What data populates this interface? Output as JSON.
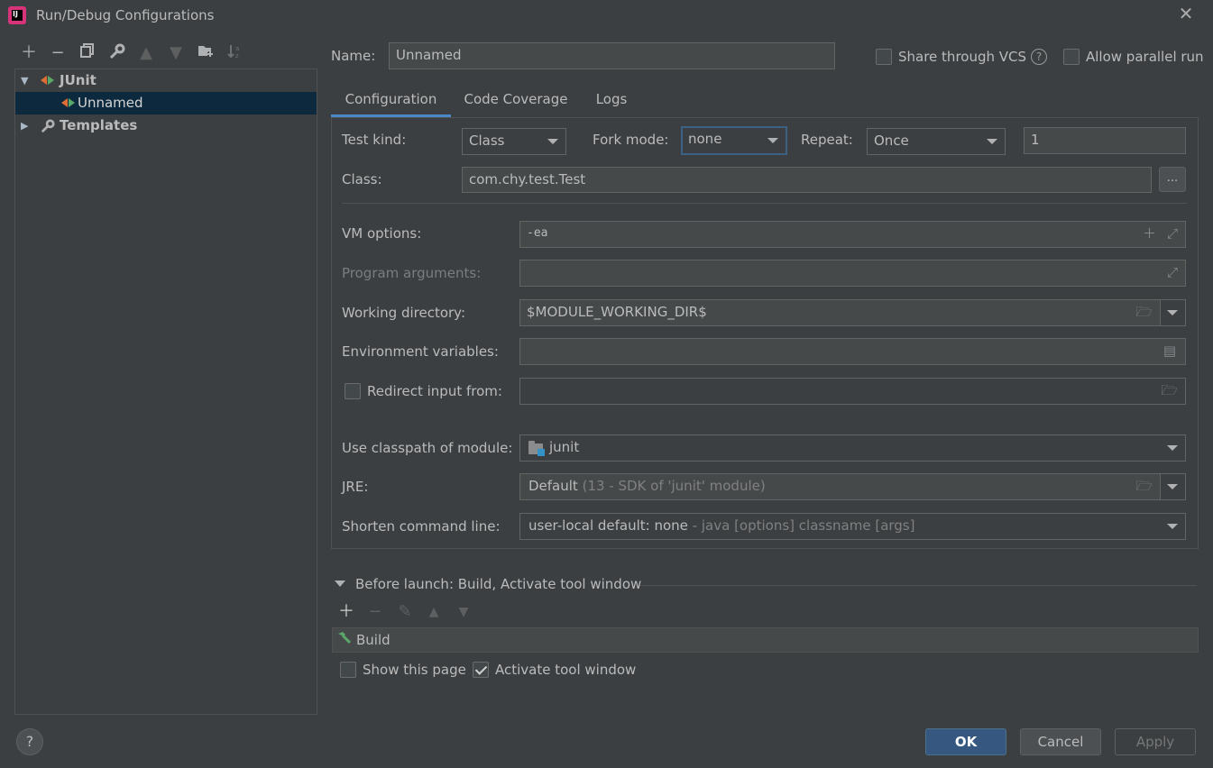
{
  "window": {
    "title": "Run/Debug Configurations",
    "logo_text": "IJ"
  },
  "toolbar": {
    "icons": [
      "add-icon",
      "remove-icon",
      "copy-icon",
      "wrench-icon",
      "move-up-icon",
      "move-down-icon",
      "new-folder-icon",
      "sort-icon"
    ]
  },
  "tree": {
    "group_label": "JUnit",
    "config_label": "Unnamed",
    "templates_label": "Templates"
  },
  "header": {
    "name_label": "Name:",
    "name_value": "Unnamed",
    "share_label": "Share through VCS",
    "help_glyph": "?",
    "parallel_label": "Allow parallel run"
  },
  "tabs": [
    {
      "label": "Configuration"
    },
    {
      "label": "Code Coverage"
    },
    {
      "label": "Logs"
    }
  ],
  "config": {
    "test_kind_label": "Test kind:",
    "test_kind_value": "Class",
    "fork_mode_label": "Fork mode:",
    "fork_mode_value": "none",
    "repeat_label": "Repeat:",
    "repeat_value": "Once",
    "repeat_count": "1",
    "class_label": "Class:",
    "class_value": "com.chy.test.Test",
    "browse_label": "...",
    "vm_options_label": "VM options:",
    "vm_options_value": "-ea",
    "program_args_label": "Program arguments:",
    "working_dir_label": "Working directory:",
    "working_dir_value": "$MODULE_WORKING_DIR$",
    "env_vars_label": "Environment variables:",
    "redirect_label": "Redirect input from:",
    "classpath_label": "Use classpath of module:",
    "classpath_value": "junit",
    "jre_label": "JRE:",
    "jre_value": "Default",
    "jre_hint": "(13 - SDK of 'junit' module)",
    "shorten_label": "Shorten command line:",
    "shorten_value": "user-local default: none",
    "shorten_hint": "- java [options] classname [args]"
  },
  "before_launch": {
    "label": "Before launch: Build, Activate tool window",
    "build_label": "Build",
    "show_page_label": "Show this page",
    "activate_label": "Activate tool window"
  },
  "footer": {
    "ok_label": "OK",
    "cancel_label": "Cancel",
    "apply_label": "Apply",
    "help_glyph": "?"
  },
  "colors": {
    "background": "#3c3f41",
    "selection": "#0d293e",
    "accent": "#4a88c7",
    "primary_button": "#365880"
  }
}
